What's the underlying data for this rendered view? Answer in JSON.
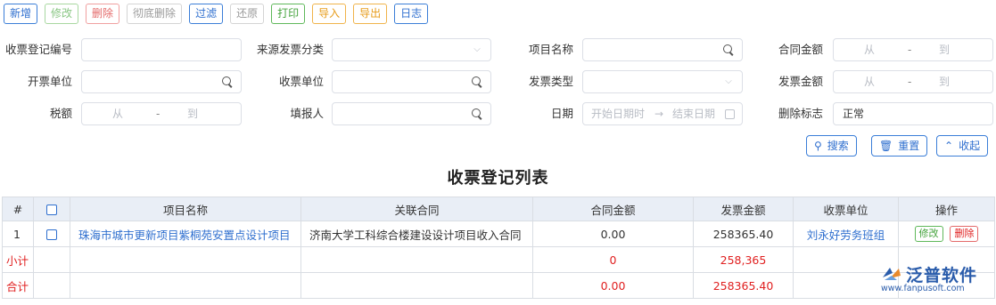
{
  "toolbar": {
    "new": "新增",
    "edit": "修改",
    "delete": "删除",
    "purge": "彻底删除",
    "filter": "过滤",
    "restore": "还原",
    "print": "打印",
    "import": "导入",
    "export": "导出",
    "log": "日志"
  },
  "form": {
    "receipt_no": {
      "label": "收票登记编号",
      "value": ""
    },
    "source_type": {
      "label": "来源发票分类",
      "value": ""
    },
    "project_name": {
      "label": "项目名称",
      "value": ""
    },
    "contract_amount": {
      "label": "合同金额",
      "from": "从",
      "sep": "-",
      "to": "到"
    },
    "issuer": {
      "label": "开票单位",
      "value": ""
    },
    "receiver": {
      "label": "收票单位",
      "value": ""
    },
    "invoice_type": {
      "label": "发票类型",
      "value": ""
    },
    "invoice_amount": {
      "label": "发票金额",
      "from": "从",
      "sep": "-",
      "to": "到"
    },
    "tax": {
      "label": "税额",
      "from": "从",
      "sep": "-",
      "to": "到"
    },
    "reporter": {
      "label": "填报人",
      "value": ""
    },
    "date": {
      "label": "日期",
      "start": "开始日期时",
      "arrow": "→",
      "end": "结束日期"
    },
    "delete_flag": {
      "label": "删除标志",
      "value": "正常"
    }
  },
  "actions": {
    "search": "搜索",
    "reset": "重置",
    "collapse": "收起"
  },
  "list": {
    "title": "收票登记列表",
    "columns": [
      "#",
      "",
      "项目名称",
      "关联合同",
      "合同金额",
      "发票金额",
      "收票单位",
      "操作"
    ],
    "rows": [
      {
        "index": "1",
        "project": "珠海市城市更新项目紫桐苑安置点设计项目",
        "contract": "济南大学工科综合楼建设设计项目收入合同",
        "contract_amount": "0.00",
        "invoice_amount": "258365.40",
        "receiver": "刘永好劳务班组",
        "edit": "修改",
        "delete": "删除"
      }
    ],
    "subtotal": {
      "label": "小计",
      "contract_amount": "0",
      "invoice_amount": "258,365"
    },
    "total": {
      "label": "合计",
      "contract_amount": "0.00",
      "invoice_amount": "258365.40"
    }
  },
  "logo": {
    "name": "泛普软件",
    "url": "www.fanpusoft.com"
  },
  "colors": {
    "accent": "#2f6fcf",
    "header_bg": "#e9eef6",
    "danger": "#e02020",
    "success": "#44a33c"
  }
}
